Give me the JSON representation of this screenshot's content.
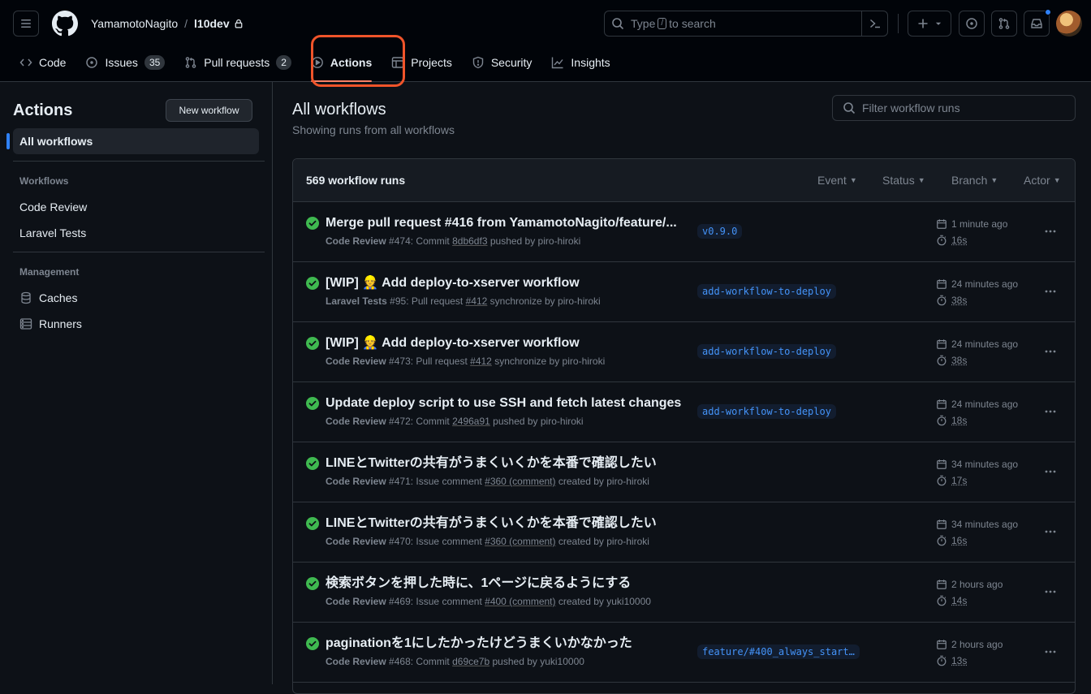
{
  "header": {
    "owner": "YamamotoNagito",
    "separator": "/",
    "repo": "l10dev",
    "search_prefix": "Type",
    "search_key": "/",
    "search_suffix": "to search"
  },
  "tabs": [
    {
      "label": "Code"
    },
    {
      "label": "Issues",
      "count": "35"
    },
    {
      "label": "Pull requests",
      "count": "2"
    },
    {
      "label": "Actions"
    },
    {
      "label": "Projects"
    },
    {
      "label": "Security"
    },
    {
      "label": "Insights"
    }
  ],
  "sidebar": {
    "title": "Actions",
    "new_workflow": "New workflow",
    "all_workflows": "All workflows",
    "workflows_heading": "Workflows",
    "workflows": [
      "Code Review",
      "Laravel Tests"
    ],
    "management_heading": "Management",
    "management": [
      "Caches",
      "Runners"
    ]
  },
  "main": {
    "title": "All workflows",
    "subtitle": "Showing runs from all workflows",
    "filter_placeholder": "Filter workflow runs",
    "run_count": "569 workflow runs",
    "filters": [
      "Event",
      "Status",
      "Branch",
      "Actor"
    ]
  },
  "runs": [
    {
      "title": "Merge pull request #416 from YamamotoNagito/feature/...",
      "workflow": "Code Review",
      "number": "#474",
      "kind": "Commit",
      "ref": "8db6df3",
      "action": "pushed by piro-hiroki",
      "branch": "v0.9.0",
      "when": "1 minute ago",
      "duration": "16s"
    },
    {
      "title": "[WIP] 👷 Add deploy-to-xserver workflow",
      "workflow": "Laravel Tests",
      "number": "#95",
      "kind": "Pull request",
      "ref": "#412",
      "action": "synchronize by piro-hiroki",
      "branch": "add-workflow-to-deploy",
      "when": "24 minutes ago",
      "duration": "38s"
    },
    {
      "title": "[WIP] 👷 Add deploy-to-xserver workflow",
      "workflow": "Code Review",
      "number": "#473",
      "kind": "Pull request",
      "ref": "#412",
      "action": "synchronize by piro-hiroki",
      "branch": "add-workflow-to-deploy",
      "when": "24 minutes ago",
      "duration": "38s"
    },
    {
      "title": "Update deploy script to use SSH and fetch latest changes",
      "workflow": "Code Review",
      "number": "#472",
      "kind": "Commit",
      "ref": "2496a91",
      "action": "pushed by piro-hiroki",
      "branch": "add-workflow-to-deploy",
      "when": "24 minutes ago",
      "duration": "18s"
    },
    {
      "title": "LINEとTwitterの共有がうまくいくかを本番で確認したい",
      "workflow": "Code Review",
      "number": "#471",
      "kind": "Issue comment",
      "ref": "#360 (comment)",
      "action": "created by piro-hiroki",
      "branch": "",
      "when": "34 minutes ago",
      "duration": "17s"
    },
    {
      "title": "LINEとTwitterの共有がうまくいくかを本番で確認したい",
      "workflow": "Code Review",
      "number": "#470",
      "kind": "Issue comment",
      "ref": "#360 (comment)",
      "action": "created by piro-hiroki",
      "branch": "",
      "when": "34 minutes ago",
      "duration": "16s"
    },
    {
      "title": "検索ボタンを押した時に、1ページに戻るようにする",
      "workflow": "Code Review",
      "number": "#469",
      "kind": "Issue comment",
      "ref": "#400 (comment)",
      "action": "created by yuki10000",
      "branch": "",
      "when": "2 hours ago",
      "duration": "14s"
    },
    {
      "title": "paginationを1にしたかったけどうまくいかなかった",
      "workflow": "Code Review",
      "number": "#468",
      "kind": "Commit",
      "ref": "d69ce7b",
      "action": "pushed by yuki10000",
      "branch": "feature/#400_always_start…",
      "when": "2 hours ago",
      "duration": "13s"
    }
  ],
  "colors": {
    "accent": "#2f81f7",
    "success": "#3fb950",
    "tab_underline": "#f78166",
    "highlight": "#f0542a"
  }
}
